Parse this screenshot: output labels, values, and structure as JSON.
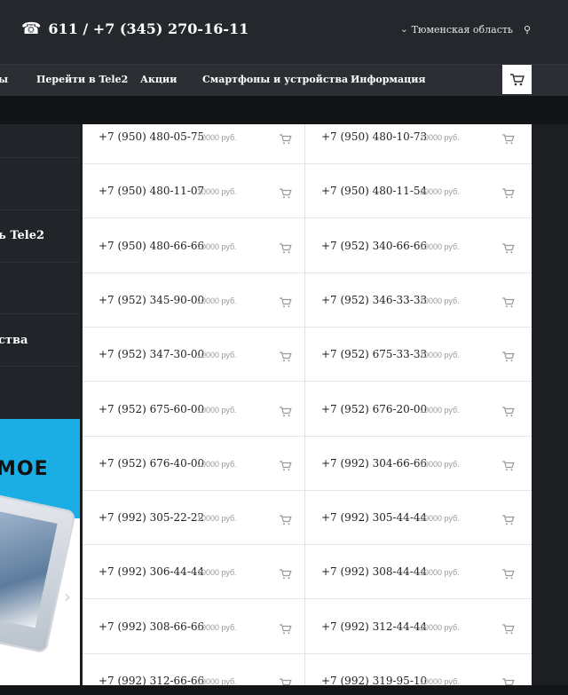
{
  "header": {
    "phone_icon": "phone-icon",
    "phone": "611 / +7 (345) 270-16-11",
    "region": "Тюменская область"
  },
  "nav": {
    "items": [
      "ы",
      "Перейти в Tele2",
      "Акции",
      "Смартфоны и устройства",
      "Информация"
    ],
    "cart_icon": "cart-icon"
  },
  "sidebar": {
    "items": [
      "ь Tele2",
      "ства"
    ]
  },
  "banner": {
    "text": "МОЕ",
    "accent": "#1aaee5"
  },
  "numbers": {
    "rows": [
      [
        {
          "number": "+7 (950) 480-05-75",
          "price": "10000 руб."
        },
        {
          "number": "+7 (950) 480-10-73",
          "price": "10000 руб."
        }
      ],
      [
        {
          "number": "+7 (950) 480-11-07",
          "price": "10000 руб."
        },
        {
          "number": "+7 (950) 480-11-54",
          "price": "10000 руб."
        }
      ],
      [
        {
          "number": "+7 (950) 480-66-66",
          "price": "10000 руб."
        },
        {
          "number": "+7 (952) 340-66-66",
          "price": "10000 руб."
        }
      ],
      [
        {
          "number": "+7 (952) 345-90-00",
          "price": "10000 руб."
        },
        {
          "number": "+7 (952) 346-33-33",
          "price": "10000 руб."
        }
      ],
      [
        {
          "number": "+7 (952) 347-30-00",
          "price": "10000 руб."
        },
        {
          "number": "+7 (952) 675-33-33",
          "price": "10000 руб."
        }
      ],
      [
        {
          "number": "+7 (952) 675-60-00",
          "price": "10000 руб."
        },
        {
          "number": "+7 (952) 676-20-00",
          "price": "10000 руб."
        }
      ],
      [
        {
          "number": "+7 (952) 676-40-00",
          "price": "10000 руб."
        },
        {
          "number": "+7 (992) 304-66-66",
          "price": "10000 руб."
        }
      ],
      [
        {
          "number": "+7 (992) 305-22-22",
          "price": "10000 руб."
        },
        {
          "number": "+7 (992) 305-44-44",
          "price": "10000 руб."
        }
      ],
      [
        {
          "number": "+7 (992) 306-44-44",
          "price": "10000 руб."
        },
        {
          "number": "+7 (992) 308-44-44",
          "price": "10000 руб."
        }
      ],
      [
        {
          "number": "+7 (992) 308-66-66",
          "price": "10000 руб."
        },
        {
          "number": "+7 (992) 312-44-44",
          "price": "10000 руб."
        }
      ],
      [
        {
          "number": "+7 (992) 312-66-66",
          "price": "10000 руб."
        },
        {
          "number": "+7 (992) 319-95-10",
          "price": "10000 руб."
        }
      ]
    ]
  }
}
